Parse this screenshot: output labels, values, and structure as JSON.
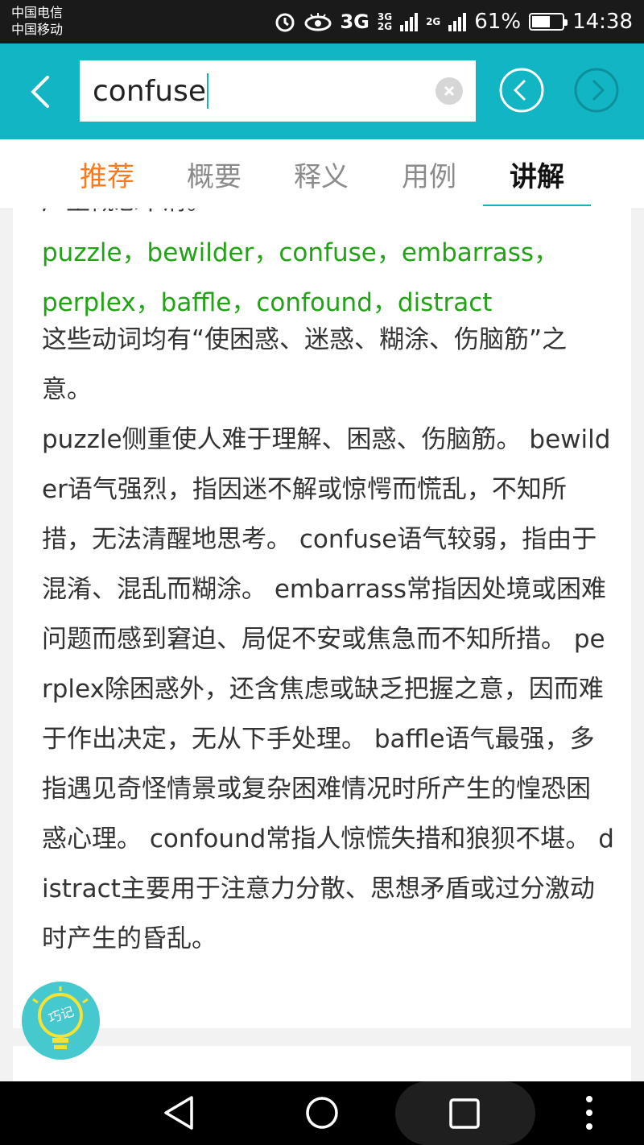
{
  "status_bar": {
    "carrier_1": "中国电信",
    "carrier_2": "中国移动",
    "network_3g": "3G",
    "net_small_1": "3G",
    "net_small_2": "2G",
    "net_small_3": "2G",
    "battery_percent": "61%",
    "battery_level": 0.61,
    "time": "14:38"
  },
  "header": {
    "search_value": "confuse",
    "accent_color": "#12b5c4"
  },
  "tabs": [
    {
      "label": "推荐"
    },
    {
      "label": "概要"
    },
    {
      "label": "释义"
    },
    {
      "label": "用例"
    },
    {
      "label": "讲解"
    }
  ],
  "content": {
    "cut_off_line": "产生概念不清。",
    "synonyms": "puzzle，bewilder，confuse，embarrass，perplex，baffle，confound，distract",
    "explanation": "这些动词均有“使困惑、迷惑、糊涂、伤脑筋”之意。",
    "details": "puzzle侧重使人难于理解、困惑、伤脑筋。 bewilder语气强烈，指因迷不解或惊愕而慌乱，不知所措，无法清醒地思考。 confuse语气较弱，指由于混淆、混乱而糊涂。 embarrass常指因处境或困难问题而感到窘迫、局促不安或焦急而不知所措。 perplex除困惑外，还含焦虑或缺乏把握之意，因而难于作出决定，无从下手处理。 baffle语气最强，多指遇见奇怪情景或复杂困难情况时所产生的惶恐困惑心理。 confound常指人惊慌失措和狼狈不堪。 distract主要用于注意力分散、思想矛盾或过分激动时产生的昏乱。"
  },
  "memo_button": {
    "label": "巧记"
  }
}
